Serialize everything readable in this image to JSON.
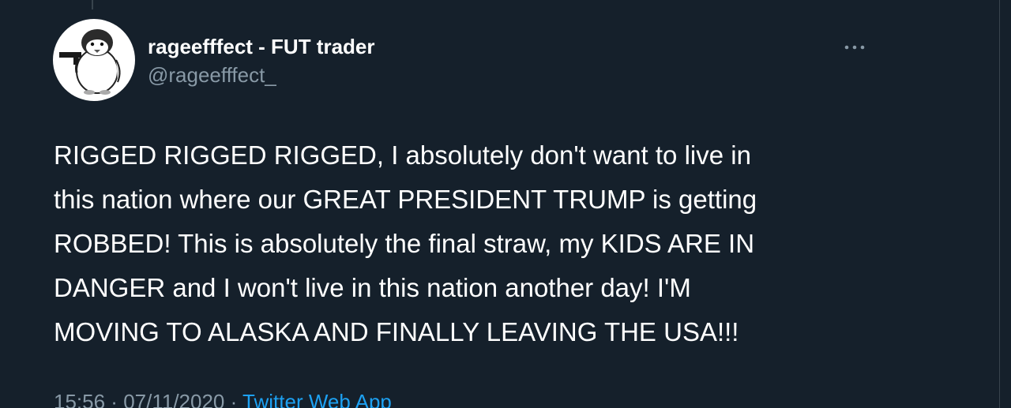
{
  "author": {
    "display_name": "rageefffect - FUT trader",
    "handle": "@rageefffect_"
  },
  "tweet": {
    "text": "RIGGED RIGGED RIGGED, I absolutely don't want to live in\nthis nation where our GREAT PRESIDENT TRUMP is getting\nROBBED! This is absolutely the final straw, my KIDS ARE IN\nDANGER and I won't live in this nation another day! I'M\nMOVING TO ALASKA AND FINALLY LEAVING THE USA!!!",
    "time": "15:56",
    "sep1": " · ",
    "date": "07/11/2020",
    "sep2": " · ",
    "source": "Twitter Web App"
  },
  "icons": {
    "more": "more-dots-icon",
    "avatar": "penguin-with-gun"
  },
  "colors": {
    "background": "#15202b",
    "text": "#ffffff",
    "secondary": "#8899a6",
    "link": "#1da1f2",
    "border": "#38444d"
  }
}
